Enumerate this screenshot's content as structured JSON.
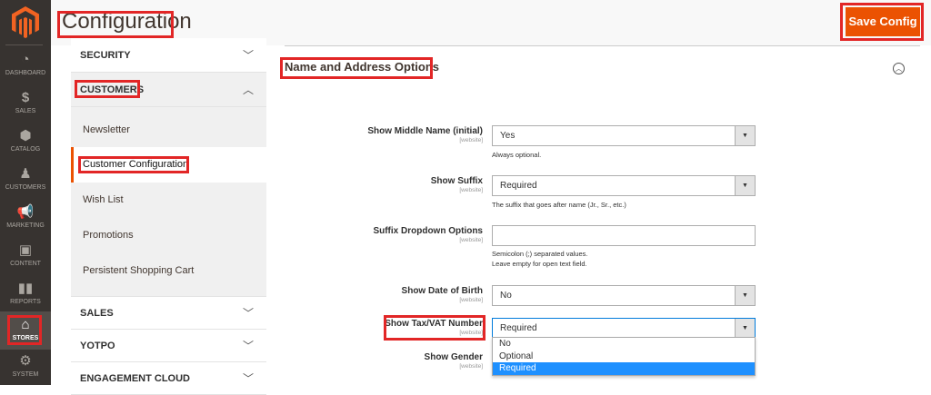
{
  "sidebar": {
    "items": [
      {
        "label": "DASHBOARD",
        "icon": "dashboard-icon"
      },
      {
        "label": "SALES",
        "icon": "dollar-icon"
      },
      {
        "label": "CATALOG",
        "icon": "box-icon"
      },
      {
        "label": "CUSTOMERS",
        "icon": "person-icon"
      },
      {
        "label": "MARKETING",
        "icon": "megaphone-icon"
      },
      {
        "label": "CONTENT",
        "icon": "layout-icon"
      },
      {
        "label": "REPORTS",
        "icon": "bar-chart-icon"
      },
      {
        "label": "STORES",
        "icon": "store-icon",
        "active": true
      },
      {
        "label": "SYSTEM",
        "icon": "gear-icon"
      }
    ]
  },
  "header": {
    "title": "Configuration",
    "save_label": "Save Config"
  },
  "tabs": {
    "security": "SECURITY",
    "customers": "CUSTOMERS",
    "customer_items": [
      "Newsletter",
      "Customer Configuration",
      "Wish List",
      "Promotions",
      "Persistent Shopping Cart"
    ],
    "sales": "SALES",
    "yotpo": "YOTPO",
    "engagement": "ENGAGEMENT CLOUD"
  },
  "section": {
    "title": "Name and Address Options"
  },
  "scope": "[website]",
  "fields": [
    {
      "label": "Show Middle Name (initial)",
      "value": "Yes",
      "note": "Always optional."
    },
    {
      "label": "Show Suffix",
      "value": "Required",
      "note": "The suffix that goes after name (Jr., Sr., etc.)"
    },
    {
      "label": "Suffix Dropdown Options",
      "value": "",
      "note1": "Semicolon (;) separated values.",
      "note2": "Leave empty for open text field."
    },
    {
      "label": "Show Date of Birth",
      "value": "No"
    },
    {
      "label": "Show Tax/VAT Number",
      "value": "Required",
      "options": [
        "No",
        "Optional",
        "Required"
      ]
    },
    {
      "label": "Show Gender"
    }
  ],
  "colors": {
    "accent": "#eb5202",
    "sidebar": "#373330",
    "highlight": "#e22626",
    "option_selected": "#1e90ff"
  }
}
